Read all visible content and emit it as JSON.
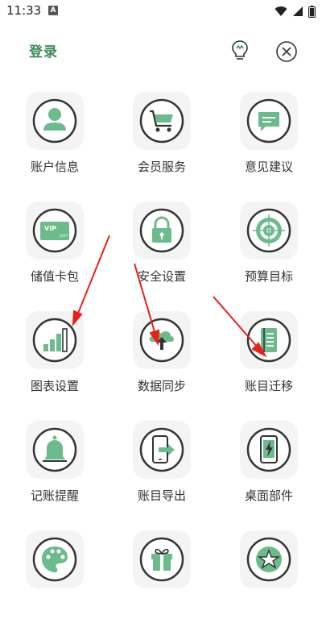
{
  "status_bar": {
    "time": "11:33",
    "notification_icon": "A",
    "icons": [
      "wifi-icon",
      "signal-icon",
      "battery-icon"
    ]
  },
  "header": {
    "login_label": "登录",
    "bulb_icon": "lightbulb-icon",
    "close_icon": "close-circle-icon"
  },
  "colors": {
    "accent": "#3d8a5a",
    "icon_green": "#6dbb8c",
    "icon_outline": "#333333",
    "tile_bg": "#f4f4f4",
    "arrow_red": "#e8201c"
  },
  "menu": {
    "items": [
      {
        "label": "账户信息",
        "icon": "user-icon"
      },
      {
        "label": "会员服务",
        "icon": "cart-icon"
      },
      {
        "label": "意见建议",
        "icon": "feedback-icon"
      },
      {
        "label": "储值卡包",
        "icon": "vip-card-icon"
      },
      {
        "label": "安全设置",
        "icon": "lock-icon"
      },
      {
        "label": "预算目标",
        "icon": "target-icon"
      },
      {
        "label": "图表设置",
        "icon": "bar-chart-icon"
      },
      {
        "label": "数据同步",
        "icon": "cloud-sync-icon"
      },
      {
        "label": "账目迁移",
        "icon": "ledger-icon"
      },
      {
        "label": "记账提醒",
        "icon": "bell-icon"
      },
      {
        "label": "账目导出",
        "icon": "phone-export-icon"
      },
      {
        "label": "桌面部件",
        "icon": "phone-widget-icon"
      },
      {
        "label": "",
        "icon": "palette-icon"
      },
      {
        "label": "",
        "icon": "gift-icon"
      },
      {
        "label": "",
        "icon": "star-icon"
      }
    ]
  }
}
